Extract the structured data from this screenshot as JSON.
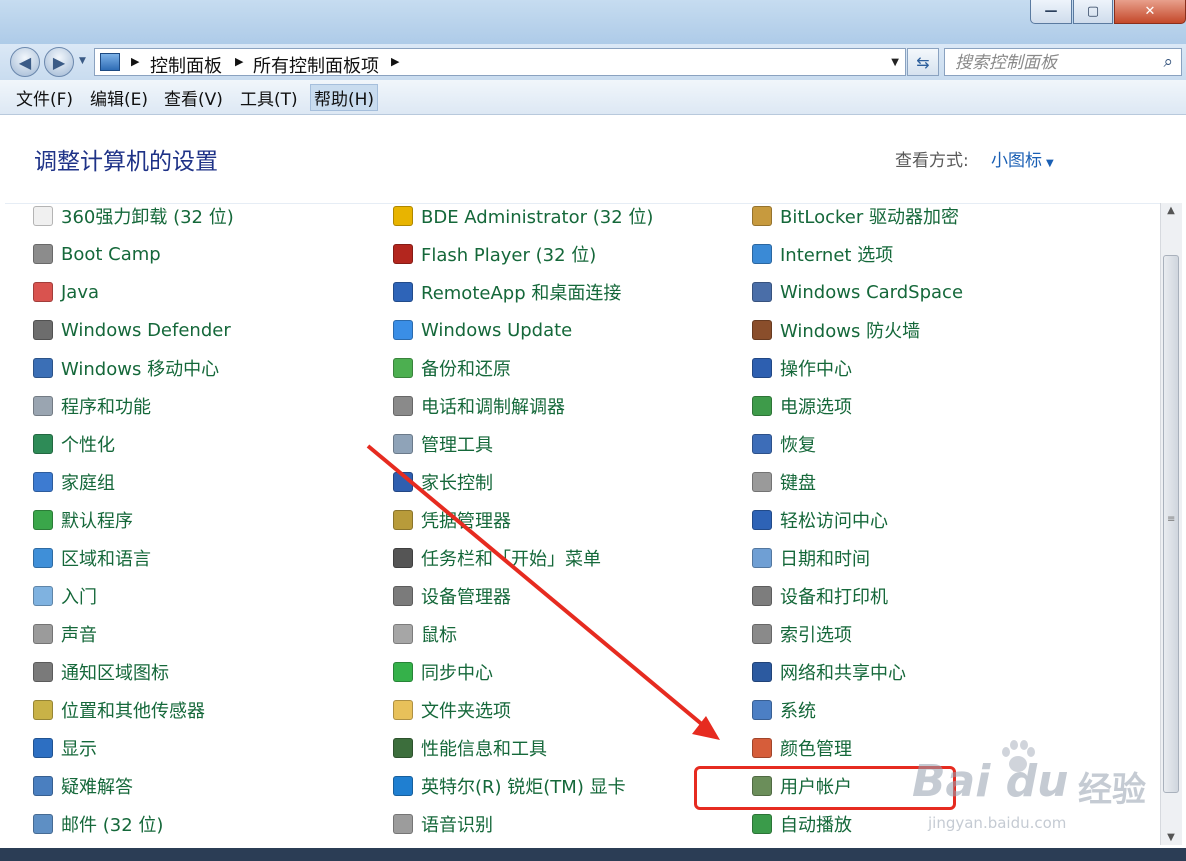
{
  "window": {
    "controls": {
      "minimize": "—",
      "maximize": "▢",
      "close": "✕"
    }
  },
  "address_bar": {
    "breadcrumbs": [
      "控制面板",
      "所有控制面板项"
    ],
    "search_placeholder": "搜索控制面板"
  },
  "menu": [
    "文件(F)",
    "编辑(E)",
    "查看(V)",
    "工具(T)",
    "帮助(H)"
  ],
  "header": {
    "title": "调整计算机的设置",
    "view_by_label": "查看方式:",
    "view_by_value": "小图标"
  },
  "items": {
    "col1": [
      {
        "label": "360强力卸载 (32 位)",
        "icon": "document-icon",
        "color": "#f0f0f0"
      },
      {
        "label": "Boot Camp",
        "icon": "bootcamp-icon",
        "color": "#8c8c8c"
      },
      {
        "label": "Java",
        "icon": "java-icon",
        "color": "#d9534f"
      },
      {
        "label": "Windows Defender",
        "icon": "defender-icon",
        "color": "#6d6d6d"
      },
      {
        "label": "Windows 移动中心",
        "icon": "mobility-icon",
        "color": "#3b6fb6"
      },
      {
        "label": "程序和功能",
        "icon": "programs-icon",
        "color": "#9aa5b1"
      },
      {
        "label": "个性化",
        "icon": "personalize-icon",
        "color": "#2e8b57"
      },
      {
        "label": "家庭组",
        "icon": "homegroup-icon",
        "color": "#3d7bd1"
      },
      {
        "label": "默认程序",
        "icon": "default-programs-icon",
        "color": "#3aa64a"
      },
      {
        "label": "区域和语言",
        "icon": "region-icon",
        "color": "#3f8fd8"
      },
      {
        "label": "入门",
        "icon": "getting-started-icon",
        "color": "#7fb2e0"
      },
      {
        "label": "声音",
        "icon": "sound-icon",
        "color": "#9b9b9b"
      },
      {
        "label": "通知区域图标",
        "icon": "notification-icon",
        "color": "#7a7a7a"
      },
      {
        "label": "位置和其他传感器",
        "icon": "sensor-icon",
        "color": "#c9b247"
      },
      {
        "label": "显示",
        "icon": "display-icon",
        "color": "#2d6fc2"
      },
      {
        "label": "疑难解答",
        "icon": "troubleshoot-icon",
        "color": "#4a7fc0"
      },
      {
        "label": "邮件 (32 位)",
        "icon": "mail-icon",
        "color": "#5e8fc4"
      }
    ],
    "col2": [
      {
        "label": "BDE Administrator (32 位)",
        "icon": "bde-icon",
        "color": "#e8b400"
      },
      {
        "label": "Flash Player (32 位)",
        "icon": "flash-icon",
        "color": "#b3261e"
      },
      {
        "label": "RemoteApp 和桌面连接",
        "icon": "remoteapp-icon",
        "color": "#2e64b8"
      },
      {
        "label": "Windows Update",
        "icon": "windows-update-icon",
        "color": "#3a8ee6"
      },
      {
        "label": "备份和还原",
        "icon": "backup-icon",
        "color": "#4caf50"
      },
      {
        "label": "电话和调制解调器",
        "icon": "phone-icon",
        "color": "#8a8a8a"
      },
      {
        "label": "管理工具",
        "icon": "admin-tools-icon",
        "color": "#8fa3b8"
      },
      {
        "label": "家长控制",
        "icon": "parental-icon",
        "color": "#2f5fb0"
      },
      {
        "label": "凭据管理器",
        "icon": "credential-icon",
        "color": "#b89b3a"
      },
      {
        "label": "任务栏和「开始」菜单",
        "icon": "taskbar-icon",
        "color": "#555555"
      },
      {
        "label": "设备管理器",
        "icon": "device-manager-icon",
        "color": "#7b7b7b"
      },
      {
        "label": "鼠标",
        "icon": "mouse-icon",
        "color": "#a6a6a6"
      },
      {
        "label": "同步中心",
        "icon": "sync-icon",
        "color": "#35b14a"
      },
      {
        "label": "文件夹选项",
        "icon": "folder-icon",
        "color": "#e8c15a"
      },
      {
        "label": "性能信息和工具",
        "icon": "performance-icon",
        "color": "#3c6e3c"
      },
      {
        "label": "英特尔(R) 锐炬(TM) 显卡",
        "icon": "intel-graphics-icon",
        "color": "#1f7fd1"
      },
      {
        "label": "语音识别",
        "icon": "microphone-icon",
        "color": "#9c9c9c"
      }
    ],
    "col3": [
      {
        "label": "BitLocker 驱动器加密",
        "icon": "bitlocker-icon",
        "color": "#c79a3e"
      },
      {
        "label": "Internet 选项",
        "icon": "internet-icon",
        "color": "#3a8ad6"
      },
      {
        "label": "Windows CardSpace",
        "icon": "cardspace-icon",
        "color": "#4a6ea8"
      },
      {
        "label": "Windows 防火墙",
        "icon": "firewall-icon",
        "color": "#8a4e2b"
      },
      {
        "label": "操作中心",
        "icon": "action-center-icon",
        "color": "#2d5fb0"
      },
      {
        "label": "电源选项",
        "icon": "power-icon",
        "color": "#3e9b4a"
      },
      {
        "label": "恢复",
        "icon": "recovery-icon",
        "color": "#3d6db8"
      },
      {
        "label": "键盘",
        "icon": "keyboard-icon",
        "color": "#9a9a9a"
      },
      {
        "label": "轻松访问中心",
        "icon": "ease-of-access-icon",
        "color": "#2e63b6"
      },
      {
        "label": "日期和时间",
        "icon": "datetime-icon",
        "color": "#6f9fd4"
      },
      {
        "label": "设备和打印机",
        "icon": "printer-icon",
        "color": "#7d7d7d"
      },
      {
        "label": "索引选项",
        "icon": "indexing-icon",
        "color": "#8a8a8a"
      },
      {
        "label": "网络和共享中心",
        "icon": "network-icon",
        "color": "#2c5aa0"
      },
      {
        "label": "系统",
        "icon": "system-icon",
        "color": "#4c7fc4"
      },
      {
        "label": "颜色管理",
        "icon": "color-management-icon",
        "color": "#d65d3a"
      },
      {
        "label": "用户帐户",
        "icon": "user-accounts-icon",
        "color": "#6b8e5a"
      },
      {
        "label": "自动播放",
        "icon": "autoplay-icon",
        "color": "#3a9b4a"
      }
    ]
  },
  "watermark": {
    "logo": "Bai du",
    "text": "经验",
    "url": "jingyan.baidu.com"
  },
  "colors": {
    "link_green": "#15683a",
    "title_blue": "#1e3287",
    "highlight_red": "#e62b20"
  }
}
